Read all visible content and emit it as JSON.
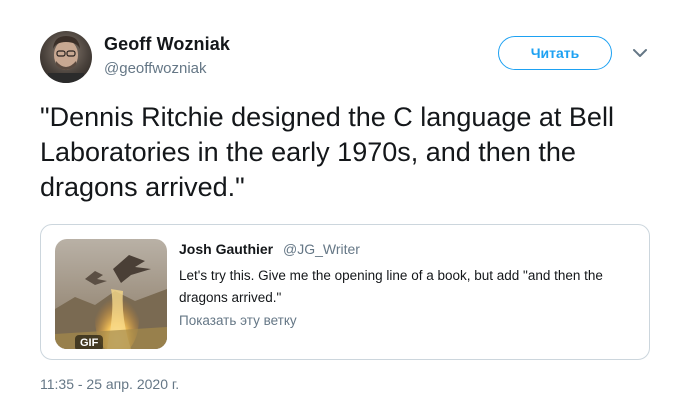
{
  "author": {
    "name": "Geoff Wozniak",
    "handle": "@geoffwozniak"
  },
  "follow_button": {
    "label": "Читать"
  },
  "more_menu": {
    "icon": "chevron-down-icon"
  },
  "tweet": {
    "text": "\"Dennis Ritchie designed the C language at Bell Laboratories in the early 1970s, and then the dragons arrived.\""
  },
  "quoted_tweet": {
    "author_name": "Josh Gauthier",
    "author_handle": "@JG_Writer",
    "text": "Let's try this. Give me the opening line of a book, but add \"and then the dragons arrived.\"",
    "thread_link": "Показать эту ветку",
    "media_badge": "GIF"
  },
  "timestamp": "11:35 - 25 апр. 2020 г.",
  "colors": {
    "accent": "#1da1f2",
    "secondary_text": "#657786",
    "border": "#ccd6dd"
  }
}
